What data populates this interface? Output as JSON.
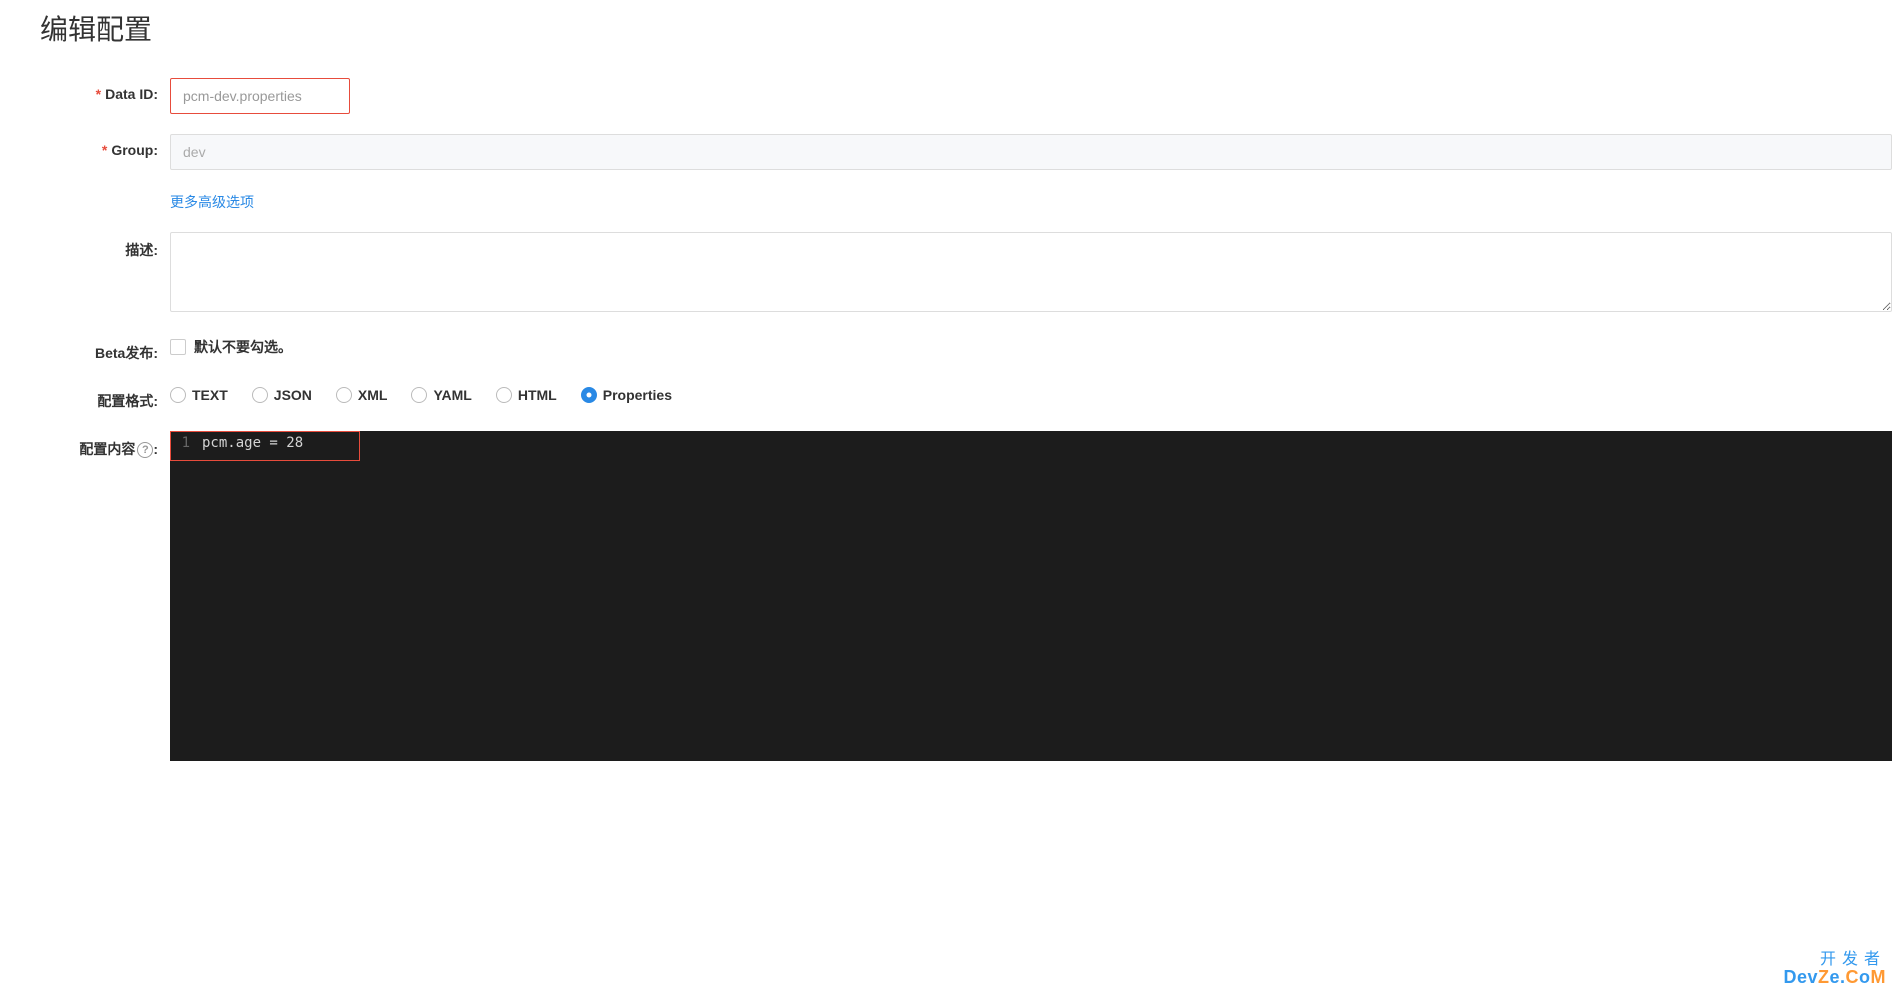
{
  "page_title": "编辑配置",
  "form": {
    "data_id": {
      "label": "Data ID:",
      "value": "pcm-dev.properties"
    },
    "group": {
      "label": "Group:",
      "value": "dev"
    },
    "more_options": "更多高级选项",
    "description": {
      "label": "描述:",
      "value": ""
    },
    "beta": {
      "label": "Beta发布:",
      "checkbox_label": "默认不要勾选。",
      "checked": false
    },
    "format": {
      "label": "配置格式:",
      "options": [
        "TEXT",
        "JSON",
        "XML",
        "YAML",
        "HTML",
        "Properties"
      ],
      "selected": "Properties"
    },
    "content": {
      "label": "配置内容",
      "help_symbol": "?",
      "colon": ":",
      "lines": [
        {
          "number": "1",
          "text": "pcm.age = 28"
        }
      ]
    }
  },
  "watermark": {
    "line1": "开发者",
    "line2_a": "Dev",
    "line2_b": "Z",
    "line2_c": "e.",
    "line2_d": "C",
    "line2_e": "o",
    "line2_f": "M"
  }
}
